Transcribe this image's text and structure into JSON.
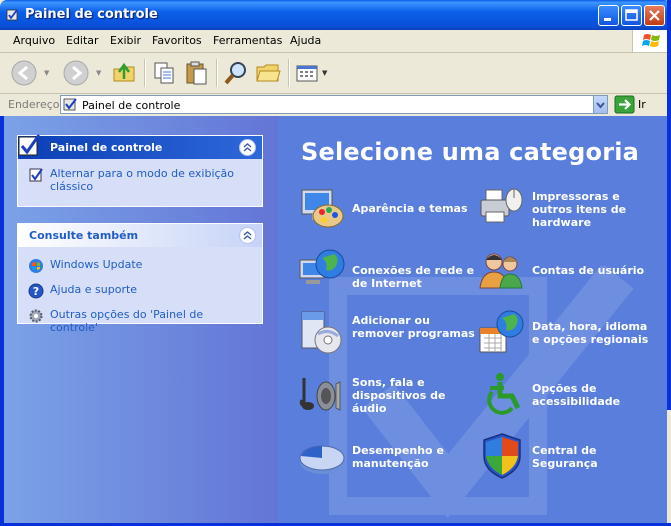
{
  "window": {
    "title": "Painel de controle"
  },
  "menu": [
    "Arquivo",
    "Editar",
    "Exibir",
    "Favoritos",
    "Ferramentas",
    "Ajuda"
  ],
  "address": {
    "label": "Endereço",
    "value": "Painel de controle",
    "go_label": "Ir"
  },
  "left_pane": {
    "control_panel": {
      "title": "Painel de controle",
      "tasks": [
        "Alternar para o modo de exibição clássico"
      ]
    },
    "see_also": {
      "title": "Consulte também",
      "links": [
        "Windows Update",
        "Ajuda e suporte",
        "Outras opções do 'Painel de controle'"
      ]
    }
  },
  "main": {
    "heading": "Selecione uma categoria",
    "categories": [
      "Aparência e temas",
      "Impressoras e outros itens de hardware",
      "Conexões de rede e de Internet",
      "Contas de usuário",
      "Adicionar ou remover programas",
      "Data, hora, idioma e opções regionais",
      "Sons, fala e dispositivos de áudio",
      "Opções de acessibilidade",
      "Desempenho e manutenção",
      "Central de Segurança"
    ]
  },
  "colors": {
    "title_bar": "#0a5ae6",
    "pane": "#5a7edc",
    "link": "#215dc6"
  }
}
